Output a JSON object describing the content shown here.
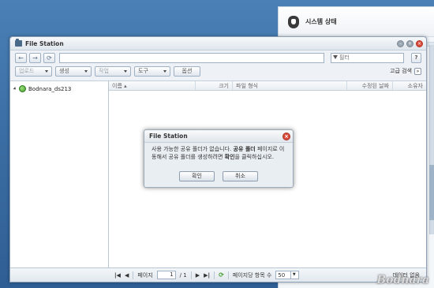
{
  "system_panel": {
    "title": "시스템 상태"
  },
  "window": {
    "title": "File Station"
  },
  "navbar": {
    "filter_placeholder": "필터",
    "help_label": "?"
  },
  "toolbar": {
    "buttons": [
      "업로드",
      "생성",
      "작업",
      "도구",
      "옵션"
    ],
    "advanced_search": "고급 검색"
  },
  "tree": {
    "root": "Bodnara_ds213"
  },
  "columns": [
    "이름 ▴",
    "크기",
    "파일 형식",
    "수정된 날짜",
    "소유자"
  ],
  "statusbar": {
    "page_label": "페이지",
    "page_value": "1",
    "page_total": "/ 1",
    "per_page_label": "페이지당 항목 수",
    "per_page_value": "50",
    "no_data": "데이터 없음"
  },
  "dialog": {
    "title": "File Station",
    "msg_part1": "사용 가능한 공유 폴더가 없습니다. ",
    "msg_bold1": "공유 폴더",
    "msg_part2": " 페이지로 이동해서 공유 폴더를 생성하려면 ",
    "msg_bold2": "확인",
    "msg_part3": "을 클릭하십시오.",
    "ok": "확인",
    "cancel": "취소"
  },
  "watermark": "Bodnara"
}
